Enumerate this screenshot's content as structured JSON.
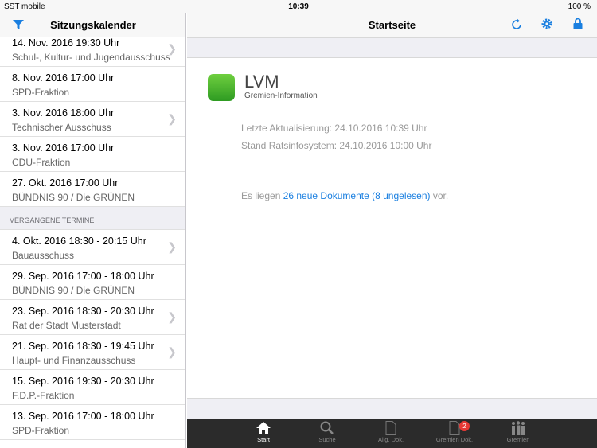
{
  "status": {
    "carrier": "SST mobile",
    "time": "10:39",
    "battery": "100 %"
  },
  "left": {
    "title": "Sitzungskalender",
    "upcoming": [
      {
        "date": "14. Nov. 2016 19:30 Uhr",
        "name": "Schul-, Kultur- und Jugendausschuss",
        "chevron": true
      },
      {
        "date": "8. Nov. 2016 17:00 Uhr",
        "name": "SPD-Fraktion",
        "chevron": false
      },
      {
        "date": "3. Nov. 2016 18:00 Uhr",
        "name": "Technischer Ausschuss",
        "chevron": true
      },
      {
        "date": "3. Nov. 2016 17:00 Uhr",
        "name": "CDU-Fraktion",
        "chevron": false
      },
      {
        "date": "27. Okt. 2016 17:00 Uhr",
        "name": "BÜNDNIS 90 / Die GRÜNEN",
        "chevron": false
      }
    ],
    "past_header": "VERGANGENE TERMINE",
    "past": [
      {
        "date": "4. Okt. 2016 18:30 - 20:15 Uhr",
        "name": "Bauausschuss",
        "chevron": true
      },
      {
        "date": "29. Sep. 2016 17:00 - 18:00 Uhr",
        "name": "BÜNDNIS 90 / Die GRÜNEN",
        "chevron": false
      },
      {
        "date": "23. Sep. 2016 18:30 - 20:30 Uhr",
        "name": "Rat der Stadt Musterstadt",
        "chevron": true
      },
      {
        "date": "21. Sep. 2016 18:30 - 19:45 Uhr",
        "name": "Haupt- und Finanzausschuss",
        "chevron": true
      },
      {
        "date": "15. Sep. 2016 19:30 - 20:30 Uhr",
        "name": "F.D.P.-Fraktion",
        "chevron": false
      },
      {
        "date": "13. Sep. 2016 17:00 - 18:00 Uhr",
        "name": "SPD-Fraktion",
        "chevron": false
      }
    ]
  },
  "main": {
    "title": "Startseite",
    "brand": "LVM",
    "brand_sub": "Gremien-Information",
    "last_update": "Letzte Aktualisierung: 24.10.2016 10:39 Uhr",
    "ris_state": "Stand Ratsinfosystem: 24.10.2016 10:00 Uhr",
    "docs_prefix": "Es liegen ",
    "docs_link": "26 neue Dokumente (8 ungelesen)",
    "docs_suffix": " vor."
  },
  "tabs": [
    {
      "label": "Start"
    },
    {
      "label": "Suche"
    },
    {
      "label": "Allg. Dok."
    },
    {
      "label": "Gremien Dok.",
      "badge": "2"
    },
    {
      "label": "Gremien"
    }
  ],
  "colors": {
    "accent": "#1a7fe0",
    "tabbar": "#2b2b2b",
    "badge": "#e53935"
  }
}
